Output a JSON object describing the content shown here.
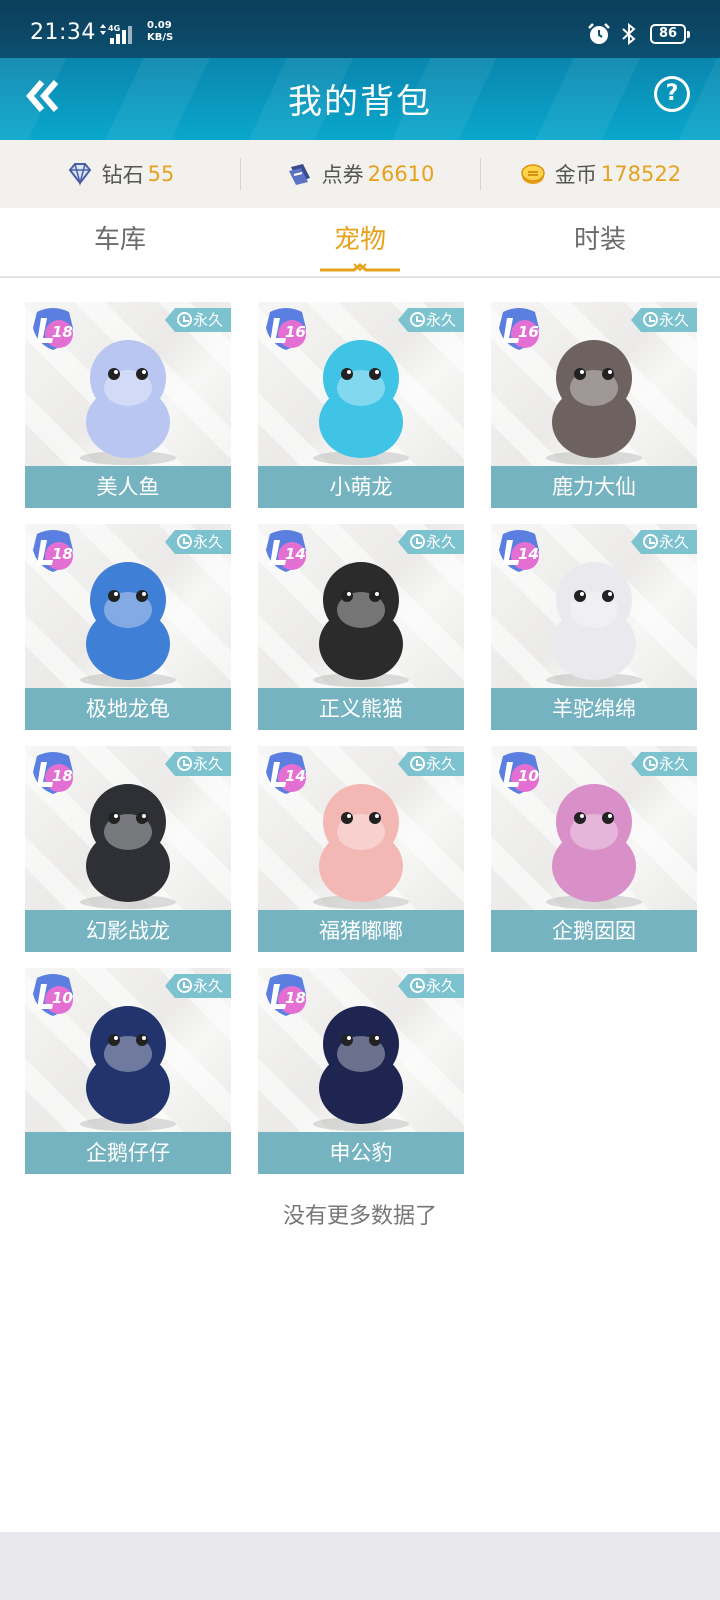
{
  "status_bar": {
    "time": "21:34",
    "network": "4G",
    "speed_value": "0.09",
    "speed_unit": "KB/S",
    "battery": "86"
  },
  "header": {
    "title": "我的背包",
    "back_icon": "double-chevron-left-icon",
    "help_icon": "help-icon",
    "help_symbol": "?"
  },
  "currencies": [
    {
      "label": "钻石",
      "value": "55",
      "icon": "diamond-icon"
    },
    {
      "label": "点券",
      "value": "26610",
      "icon": "voucher-icon"
    },
    {
      "label": "金币",
      "value": "178522",
      "icon": "coin-icon"
    }
  ],
  "tabs": [
    {
      "label": "车库"
    },
    {
      "label": "宠物",
      "active": true
    },
    {
      "label": "时装"
    }
  ],
  "pets": [
    {
      "name": "美人鱼",
      "level": "18",
      "duration": "永久",
      "color": "#b9c6f2"
    },
    {
      "name": "小萌龙",
      "level": "16",
      "duration": "永久",
      "color": "#3fc4e6"
    },
    {
      "name": "鹿力大仙",
      "level": "16",
      "duration": "永久",
      "color": "#6d625f"
    },
    {
      "name": "极地龙龟",
      "level": "18",
      "duration": "永久",
      "color": "#3f7fd6"
    },
    {
      "name": "正义熊猫",
      "level": "14",
      "duration": "永久",
      "color": "#2b2b2b"
    },
    {
      "name": "羊驼绵绵",
      "level": "14",
      "duration": "永久",
      "color": "#e9e9ee"
    },
    {
      "name": "幻影战龙",
      "level": "18",
      "duration": "永久",
      "color": "#2e3035"
    },
    {
      "name": "福猪嘟嘟",
      "level": "14",
      "duration": "永久",
      "color": "#f4b8b4"
    },
    {
      "name": "企鹅囡囡",
      "level": "10",
      "duration": "永久",
      "color": "#d98fc7"
    },
    {
      "name": "企鹅仔仔",
      "level": "10",
      "duration": "永久",
      "color": "#22346b"
    },
    {
      "name": "申公豹",
      "level": "18",
      "duration": "永久",
      "color": "#1d2550"
    }
  ],
  "footer": {
    "no_more_text": "没有更多数据了"
  }
}
